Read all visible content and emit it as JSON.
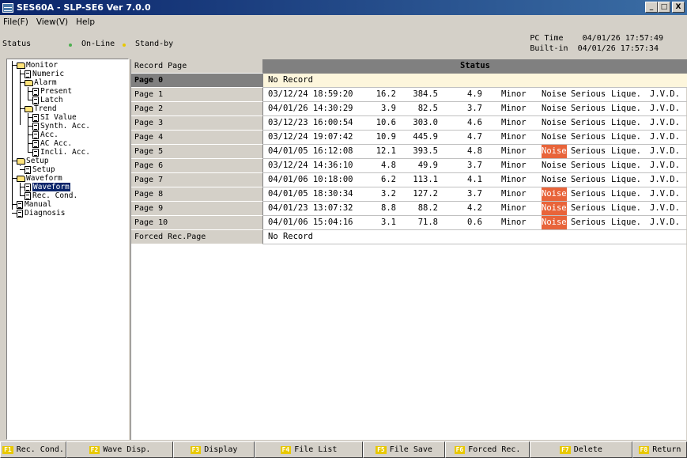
{
  "window": {
    "title": "SES60A - SLP-SE6 Ver 7.0.0",
    "buttons": [
      "_",
      "□",
      "X"
    ]
  },
  "menu": [
    "File(F)",
    "View(V)",
    "Help"
  ],
  "status": {
    "label": "Status",
    "online": "On-Line",
    "standby": "Stand-by",
    "pc_time_label": "PC Time",
    "pc_time": "04/01/26 17:57:49",
    "builtin_label": "Built-in",
    "builtin_time": "04/01/26 17:57:34"
  },
  "tree": [
    {
      "label": "Monitor",
      "icon": "folder-icon",
      "level": 0
    },
    {
      "label": "Numeric",
      "icon": "document-icon",
      "level": 1
    },
    {
      "label": "Alarm",
      "icon": "folder-icon",
      "level": 1
    },
    {
      "label": "Present",
      "icon": "document-icon",
      "level": 2
    },
    {
      "label": "Latch",
      "icon": "document-icon",
      "level": 2
    },
    {
      "label": "Trend",
      "icon": "folder-icon",
      "level": 1
    },
    {
      "label": "SI Value",
      "icon": "document-icon",
      "level": 2
    },
    {
      "label": "Synth. Acc.",
      "icon": "document-icon",
      "level": 2
    },
    {
      "label": "Acc.",
      "icon": "document-icon",
      "level": 2
    },
    {
      "label": "AC Acc.",
      "icon": "document-icon",
      "level": 2
    },
    {
      "label": "Incli. Acc.",
      "icon": "document-icon",
      "level": 2
    },
    {
      "label": "Setup",
      "icon": "folder-icon",
      "level": 0
    },
    {
      "label": "Setup",
      "icon": "document-icon",
      "level": 1
    },
    {
      "label": "Waveform",
      "icon": "folder-icon",
      "level": 0
    },
    {
      "label": "Waveform",
      "icon": "document-icon",
      "level": 1,
      "selected": true
    },
    {
      "label": "Rec. Cond.",
      "icon": "document-icon",
      "level": 1
    },
    {
      "label": "Manual",
      "icon": "document-icon",
      "level": 0
    },
    {
      "label": "Diagnosis",
      "icon": "document-icon",
      "level": 0
    }
  ],
  "table": {
    "header_left": "Record Page",
    "header_right": "Status",
    "rows": [
      {
        "page": "Page  0",
        "text": "No Record"
      },
      {
        "page": "Page  1",
        "date": "03/12/24 18:59:20",
        "v1": "16.2",
        "v2": "384.5",
        "v3": "4.9",
        "lvl": "Minor",
        "n": "Noise",
        "s": "Serious",
        "q": "Lique.",
        "j": "J.V.D.",
        "hl": false
      },
      {
        "page": "Page  2",
        "date": "04/01/26 14:30:29",
        "v1": "3.9",
        "v2": "82.5",
        "v3": "3.7",
        "lvl": "Minor",
        "n": "Noise",
        "s": "Serious",
        "q": "Lique.",
        "j": "J.V.D.",
        "hl": false
      },
      {
        "page": "Page  3",
        "date": "03/12/23 16:00:54",
        "v1": "10.6",
        "v2": "303.0",
        "v3": "4.6",
        "lvl": "Minor",
        "n": "Noise",
        "s": "Serious",
        "q": "Lique.",
        "j": "J.V.D.",
        "hl": false
      },
      {
        "page": "Page  4",
        "date": "03/12/24 19:07:42",
        "v1": "10.9",
        "v2": "445.9",
        "v3": "4.7",
        "lvl": "Minor",
        "n": "Noise",
        "s": "Serious",
        "q": "Lique.",
        "j": "J.V.D.",
        "hl": false
      },
      {
        "page": "Page  5",
        "date": "04/01/05 16:12:08",
        "v1": "12.1",
        "v2": "393.5",
        "v3": "4.8",
        "lvl": "Minor",
        "n": "Noise",
        "s": "Serious",
        "q": "Lique.",
        "j": "J.V.D.",
        "hl": true
      },
      {
        "page": "Page  6",
        "date": "03/12/24 14:36:10",
        "v1": "4.8",
        "v2": "49.9",
        "v3": "3.7",
        "lvl": "Minor",
        "n": "Noise",
        "s": "Serious",
        "q": "Lique.",
        "j": "J.V.D.",
        "hl": false
      },
      {
        "page": "Page  7",
        "date": "04/01/06 10:18:00",
        "v1": "6.2",
        "v2": "113.1",
        "v3": "4.1",
        "lvl": "Minor",
        "n": "Noise",
        "s": "Serious",
        "q": "Lique.",
        "j": "J.V.D.",
        "hl": false
      },
      {
        "page": "Page  8",
        "date": "04/01/05 18:30:34",
        "v1": "3.2",
        "v2": "127.2",
        "v3": "3.7",
        "lvl": "Minor",
        "n": "Noise",
        "s": "Serious",
        "q": "Lique.",
        "j": "J.V.D.",
        "hl": true
      },
      {
        "page": "Page  9",
        "date": "04/01/23 13:07:32",
        "v1": "8.8",
        "v2": "88.2",
        "v3": "4.2",
        "lvl": "Minor",
        "n": "Noise",
        "s": "Serious",
        "q": "Lique.",
        "j": "J.V.D.",
        "hl": true
      },
      {
        "page": "Page  10",
        "date": "04/01/06 15:04:16",
        "v1": "3.1",
        "v2": "71.8",
        "v3": "0.6",
        "lvl": "Minor",
        "n": "Noise",
        "s": "Serious",
        "q": "Lique.",
        "j": "J.V.D.",
        "hl": true
      },
      {
        "page": "Forced Rec.Page",
        "text": "No Record"
      }
    ]
  },
  "function_keys": [
    {
      "key": "F1",
      "label": "Rec. Cond."
    },
    {
      "key": "F2",
      "label": "Wave Disp."
    },
    {
      "key": "F3",
      "label": "Display"
    },
    {
      "key": "F4",
      "label": "File List"
    },
    {
      "key": "F5",
      "label": "File Save"
    },
    {
      "key": "F6",
      "label": "Forced Rec."
    },
    {
      "key": "F7",
      "label": "Delete"
    },
    {
      "key": "F8",
      "label": "Return"
    }
  ],
  "colors": {
    "title_bar": "#0a246a",
    "noise_highlight": "#e8643a",
    "online_dot": "#4caf50",
    "standby_dot": "#e8c800",
    "fkey_badge": "#e8c800"
  }
}
